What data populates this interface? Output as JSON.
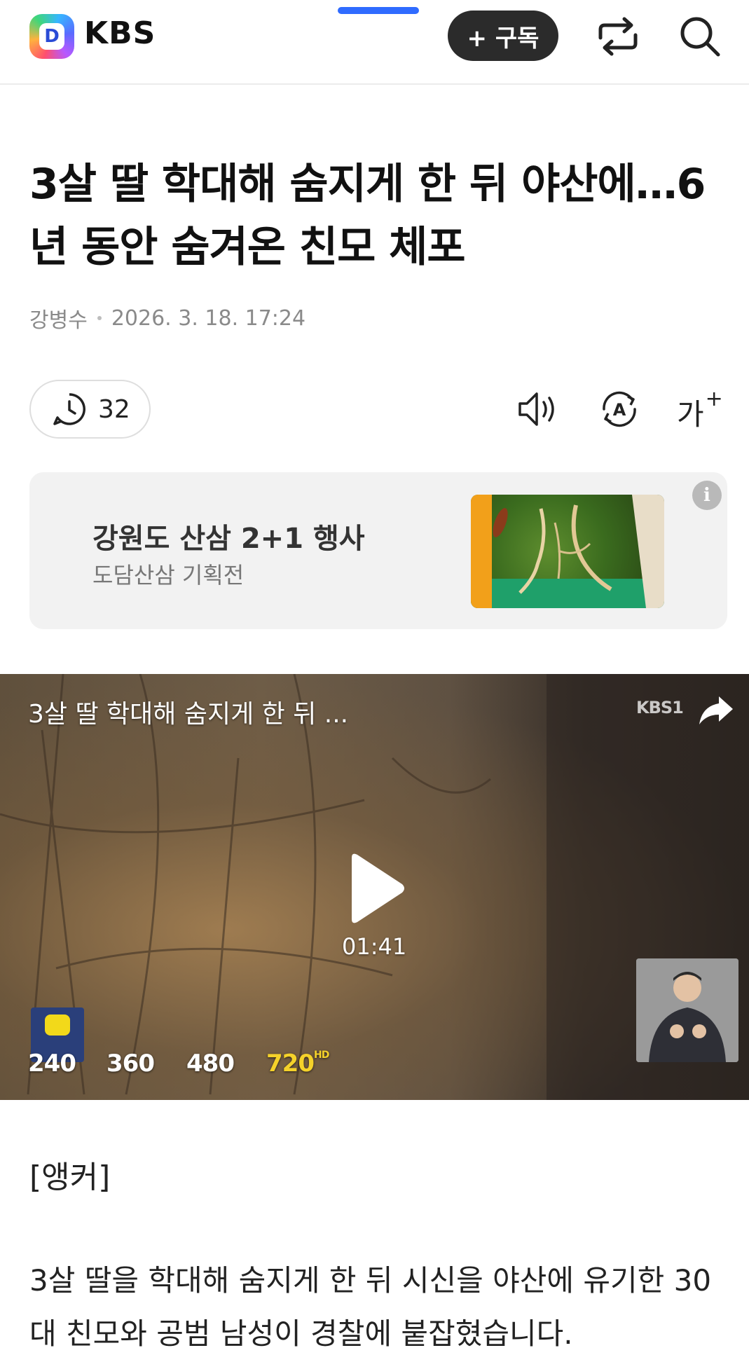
{
  "header": {
    "brand": "KBS",
    "logo_letter": "D",
    "subscribe_label": "+ 구독",
    "share_icon": "share-icon",
    "search_icon": "search-icon"
  },
  "article": {
    "headline": "3살 딸 학대해 숨지게 한 뒤 야산에…6년 동안 숨겨온 친모 체포",
    "author": "강병수",
    "datetime": "2026. 3. 18. 17:24",
    "comment_count": "32"
  },
  "tools": {
    "listen_icon": "speaker-icon",
    "translate_icon": "translate-icon",
    "font_size_label": "가"
  },
  "ad": {
    "title": "강원도 산삼 2+1 행사",
    "subtitle": "도담산삼 기획전",
    "info_label": "i"
  },
  "video": {
    "title": "3살 딸 학대해 숨지게 한 뒤 ...",
    "channel_badge": "KBS1",
    "duration": "01:41",
    "qualities": [
      "240",
      "360",
      "480",
      "720"
    ],
    "quality_hd_label": "HD",
    "selected_quality": "720"
  },
  "body": {
    "section_label": "[앵커]",
    "paragraph": "3살 딸을 학대해 숨지게 한 뒤 시신을 야산에 유기한 30대 친모와 공범 남성이 경찰에 붙잡혔습니다."
  },
  "colors": {
    "accent_blue": "#2f6bff",
    "subscribe_bg": "#2b2b2b",
    "hd_yellow": "#f5d22a"
  }
}
